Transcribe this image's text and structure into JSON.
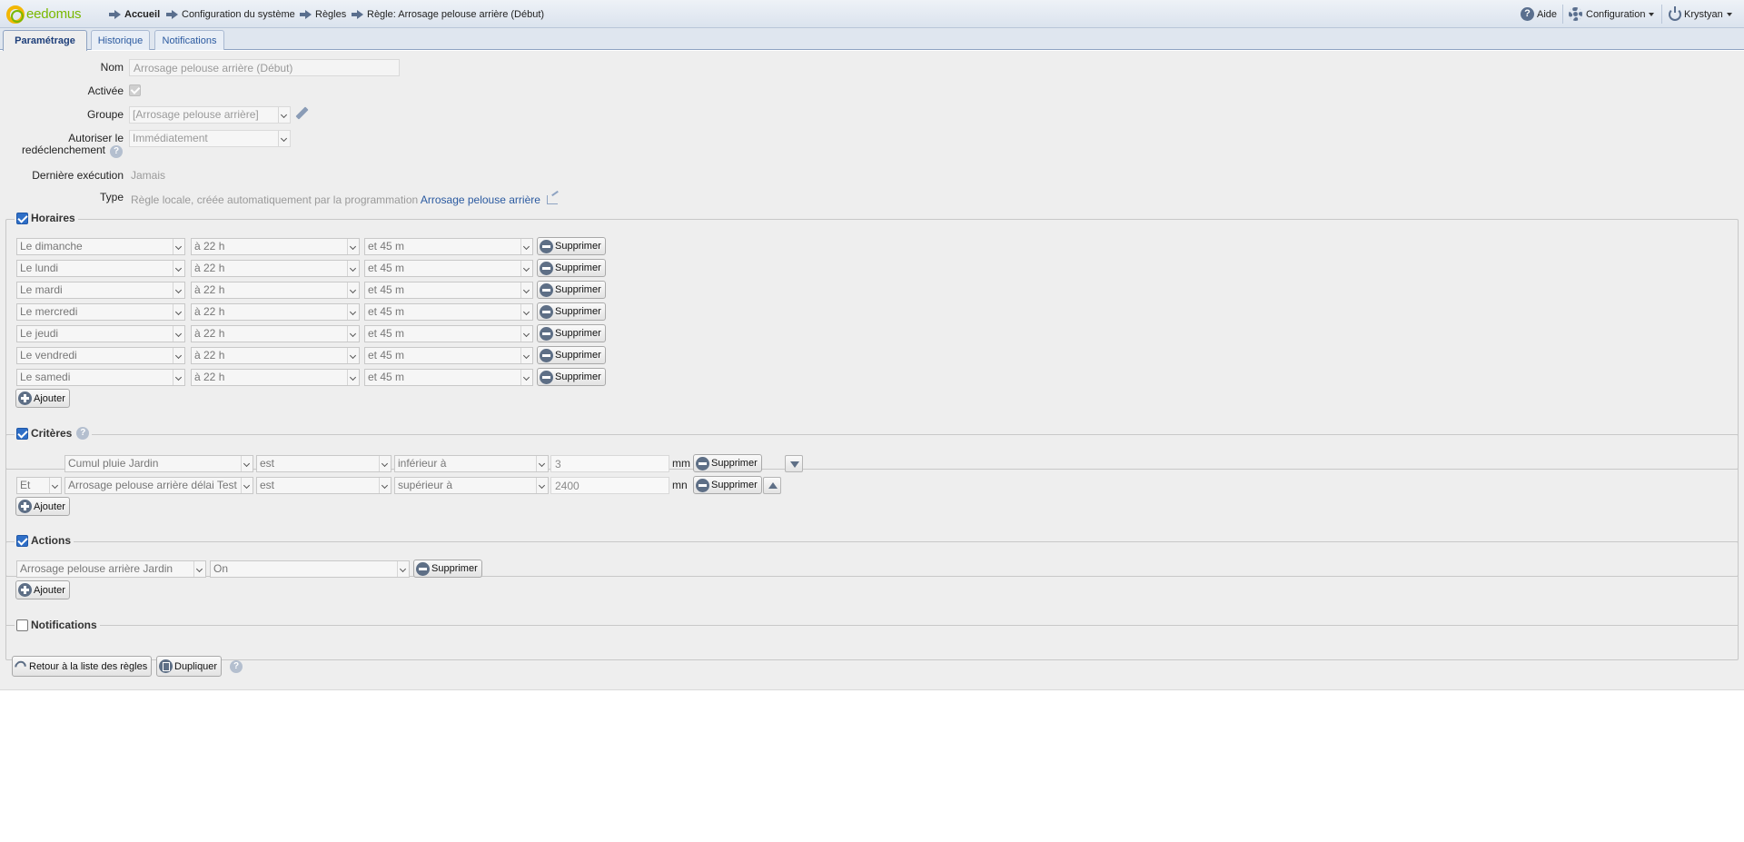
{
  "header": {
    "logo_text": "eedomus",
    "breadcrumbs": [
      "Accueil",
      "Configuration du système",
      "Règles",
      "Règle: Arrosage pelouse arrière (Début)"
    ],
    "help_label": "Aide",
    "config_label": "Configuration",
    "user_label": "Krystyan"
  },
  "tabs": [
    "Paramétrage",
    "Historique",
    "Notifications"
  ],
  "form": {
    "nom_label": "Nom",
    "nom_value": "Arrosage pelouse arrière (Début)",
    "activee_label": "Activée",
    "groupe_label": "Groupe",
    "groupe_value": "[Arrosage pelouse arrière]",
    "autoriser_label_1": "Autoriser le",
    "autoriser_label_2": "redéclenchement",
    "autoriser_value": "Immédiatement",
    "derniere_label": "Dernière exécution",
    "derniere_value": "Jamais",
    "type_label": "Type",
    "type_value": "Règle locale, créée automatiquement par la programmation",
    "type_link": "Arrosage pelouse arrière"
  },
  "horaires": {
    "legend": "Horaires",
    "checked": true,
    "rows": [
      {
        "day": "Le dimanche",
        "hour": "à 22 h",
        "minute": "et 45 m"
      },
      {
        "day": "Le lundi",
        "hour": "à 22 h",
        "minute": "et 45 m"
      },
      {
        "day": "Le mardi",
        "hour": "à 22 h",
        "minute": "et 45 m"
      },
      {
        "day": "Le mercredi",
        "hour": "à 22 h",
        "minute": "et 45 m"
      },
      {
        "day": "Le jeudi",
        "hour": "à 22 h",
        "minute": "et 45 m"
      },
      {
        "day": "Le vendredi",
        "hour": "à 22 h",
        "minute": "et 45 m"
      },
      {
        "day": "Le samedi",
        "hour": "à 22 h",
        "minute": "et 45 m"
      }
    ]
  },
  "criteres": {
    "legend": "Critères",
    "checked": true,
    "rows": [
      {
        "connector": "",
        "device": "Cumul pluie Jardin",
        "verb": "est",
        "op": "inférieur à",
        "value": "3",
        "unit": "mm"
      },
      {
        "connector": "Et",
        "device": "Arrosage pelouse arrière délai Test",
        "verb": "est",
        "op": "supérieur à",
        "value": "2400",
        "unit": "mn"
      }
    ]
  },
  "actions": {
    "legend": "Actions",
    "checked": true,
    "rows": [
      {
        "device": "Arrosage pelouse arrière Jardin",
        "value": "On"
      }
    ]
  },
  "notifications": {
    "legend": "Notifications",
    "checked": false
  },
  "buttons": {
    "supprimer": "Supprimer",
    "ajouter": "Ajouter",
    "retour": "Retour à la liste des règles",
    "dupliquer": "Dupliquer"
  },
  "colors": {
    "accent": "#2f6fc7",
    "link": "#2b5aa0",
    "icon": "#5e6f86",
    "logo_green": "#7ab800",
    "logo_yellow": "#f2b705"
  }
}
